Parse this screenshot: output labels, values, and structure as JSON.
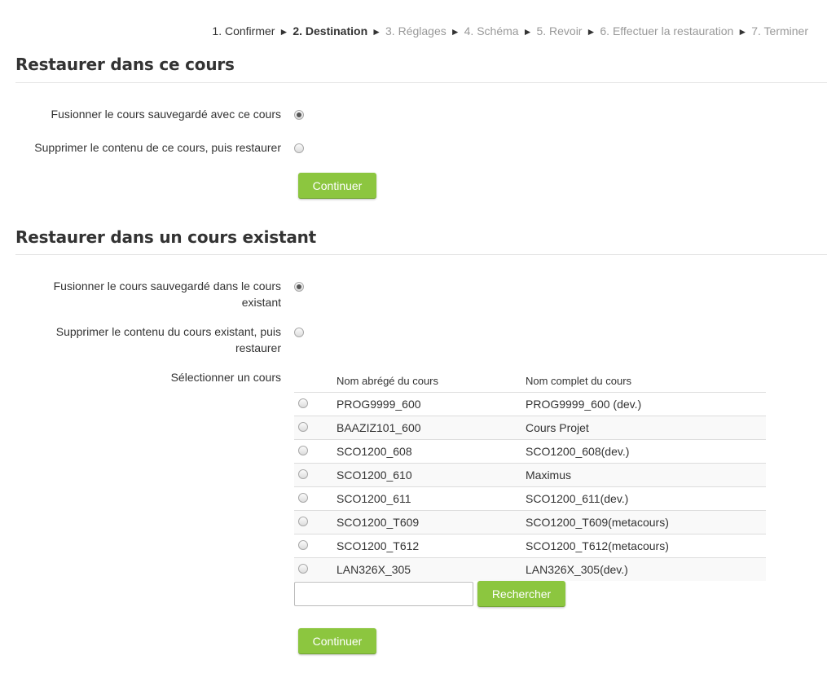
{
  "progress": {
    "steps": [
      {
        "label": "1. Confirmer",
        "state": "done"
      },
      {
        "label": "2. Destination",
        "state": "current"
      },
      {
        "label": "3. Réglages",
        "state": "todo"
      },
      {
        "label": "4. Schéma",
        "state": "todo"
      },
      {
        "label": "5. Revoir",
        "state": "todo"
      },
      {
        "label": "6. Effectuer la restauration",
        "state": "todo"
      },
      {
        "label": "7. Terminer",
        "state": "todo"
      }
    ],
    "separator": "►"
  },
  "section1": {
    "title": "Restaurer dans ce cours",
    "options": [
      {
        "label": "Fusionner le cours sauvegardé avec ce cours",
        "checked": true
      },
      {
        "label": "Supprimer le contenu de ce cours, puis restaurer",
        "checked": false
      }
    ],
    "continue_label": "Continuer"
  },
  "section2": {
    "title": "Restaurer dans un cours existant",
    "options": [
      {
        "label": "Fusionner le cours sauvegardé dans le cours existant",
        "checked": true
      },
      {
        "label": "Supprimer le contenu du cours existant, puis restaurer",
        "checked": false
      }
    ],
    "select_label": "Sélectionner un cours",
    "table": {
      "headers": [
        "Nom abrégé du cours",
        "Nom complet du cours"
      ],
      "rows": [
        [
          "PROG9999_600",
          "PROG9999_600 (dev.)"
        ],
        [
          "BAAZIZ101_600",
          "Cours Projet"
        ],
        [
          "SCO1200_608",
          "SCO1200_608(dev.)"
        ],
        [
          "SCO1200_610",
          "Maximus"
        ],
        [
          "SCO1200_611",
          "SCO1200_611(dev.)"
        ],
        [
          "SCO1200_T609",
          "SCO1200_T609(metacours)"
        ],
        [
          "SCO1200_T612",
          "SCO1200_T612(metacours)"
        ],
        [
          "LAN326X_305",
          "LAN326X_305(dev.)"
        ]
      ]
    },
    "search": {
      "value": "",
      "button_label": "Rechercher"
    },
    "continue_label": "Continuer"
  },
  "colors": {
    "accent": "#8cc63f",
    "text": "#333333",
    "muted": "#999999"
  }
}
